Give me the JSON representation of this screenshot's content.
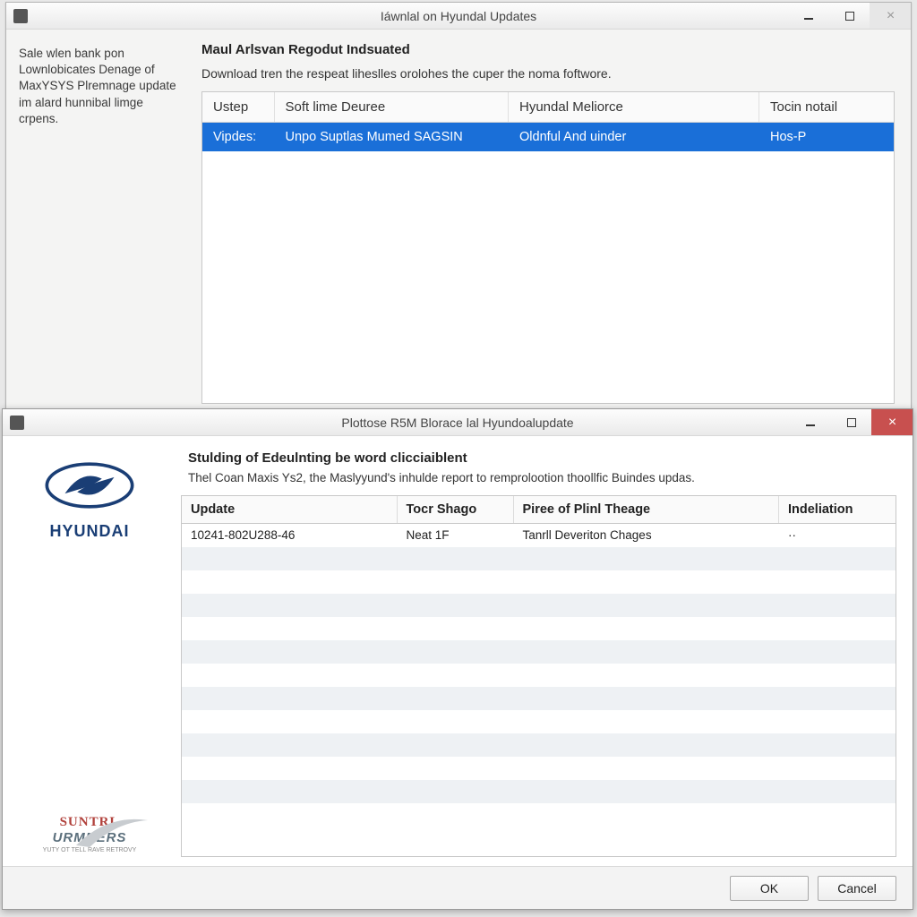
{
  "win1": {
    "title": "Iáwnlal on Hyundal Updates",
    "sidebar_text": "Sale wlen bank pon Lownlobicates Denage of MaxYSYS Plremnage update im alard hunnibal limge crpens.",
    "heading": "Maul Arlsvan Regodut Indsuated",
    "subtext": "Download tren the respeat liheslles orolohes the cuper the noma foftwore.",
    "table": {
      "columns": [
        "Ustep",
        "Soft lime Deuree",
        "Hyundal Meliorce",
        "Tocin notail"
      ],
      "rows": [
        {
          "c0": "Vipdes:",
          "c1": "Unpo Suptlas Mumed SAGSIN",
          "c2": "Oldnful And uinder",
          "c3": "Hos-P",
          "selected": true
        }
      ]
    }
  },
  "win2": {
    "title": "Plottose R5M Blorace lal Hyundoalupdate",
    "brand": "HYUNDAI",
    "badge": {
      "line1": "SUNTRL",
      "line2": "URMNERS",
      "line3": "YUTY OT TELL RAVE RETROVY"
    },
    "heading": "Stulding of Edeulnting be word clicciaiblent",
    "subtext": "Thel Coan Maxis Ys2, the Maslyyund's inhulde report to remprolootion thoollfic Buindes updas.",
    "table": {
      "columns": [
        "Update",
        "Tocr Shago",
        "Piree of Plinl Theage",
        "Indeliation"
      ],
      "rows": [
        {
          "c0": "10241-802U288-46",
          "c1": "Neat 1F",
          "c2": "Tanrll Deveriton Chages",
          "c3": "··"
        }
      ]
    },
    "buttons": {
      "ok": "OK",
      "cancel": "Cancel"
    }
  }
}
